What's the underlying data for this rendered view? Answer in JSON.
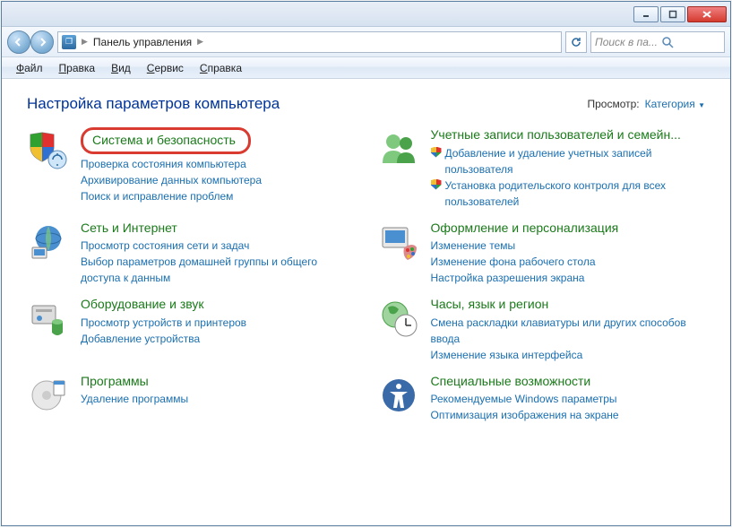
{
  "window": {
    "breadcrumb": "Панель управления",
    "search_placeholder": "Поиск в па..."
  },
  "menu": {
    "file": "Файл",
    "edit": "Правка",
    "view": "Вид",
    "tools": "Сервис",
    "help": "Справка"
  },
  "header": {
    "title": "Настройка параметров компьютера",
    "view_label": "Просмотр:",
    "view_value": "Категория"
  },
  "categories": [
    {
      "title": "Система и безопасность",
      "highlight": true,
      "subs": [
        {
          "text": "Проверка состояния компьютера"
        },
        {
          "text": "Архивирование данных компьютера"
        },
        {
          "text": "Поиск и исправление проблем"
        }
      ]
    },
    {
      "title": "Учетные записи пользователей и семейн...",
      "subs": [
        {
          "text": "Добавление и удаление учетных записей пользователя",
          "shield": true
        },
        {
          "text": "Установка родительского контроля для всех пользователей",
          "shield": true
        }
      ]
    },
    {
      "title": "Сеть и Интернет",
      "subs": [
        {
          "text": "Просмотр состояния сети и задач"
        },
        {
          "text": "Выбор параметров домашней группы и общего доступа к данным"
        }
      ]
    },
    {
      "title": "Оформление и персонализация",
      "subs": [
        {
          "text": "Изменение темы"
        },
        {
          "text": "Изменение фона рабочего стола"
        },
        {
          "text": "Настройка разрешения экрана"
        }
      ]
    },
    {
      "title": "Оборудование и звук",
      "subs": [
        {
          "text": "Просмотр устройств и принтеров"
        },
        {
          "text": "Добавление устройства"
        }
      ]
    },
    {
      "title": "Часы, язык и регион",
      "subs": [
        {
          "text": "Смена раскладки клавиатуры или других способов ввода"
        },
        {
          "text": "Изменение языка интерфейса"
        }
      ]
    },
    {
      "title": "Программы",
      "subs": [
        {
          "text": "Удаление программы"
        }
      ]
    },
    {
      "title": "Специальные возможности",
      "subs": [
        {
          "text": "Рекомендуемые Windows параметры"
        },
        {
          "text": "Оптимизация изображения на экране"
        }
      ]
    }
  ]
}
